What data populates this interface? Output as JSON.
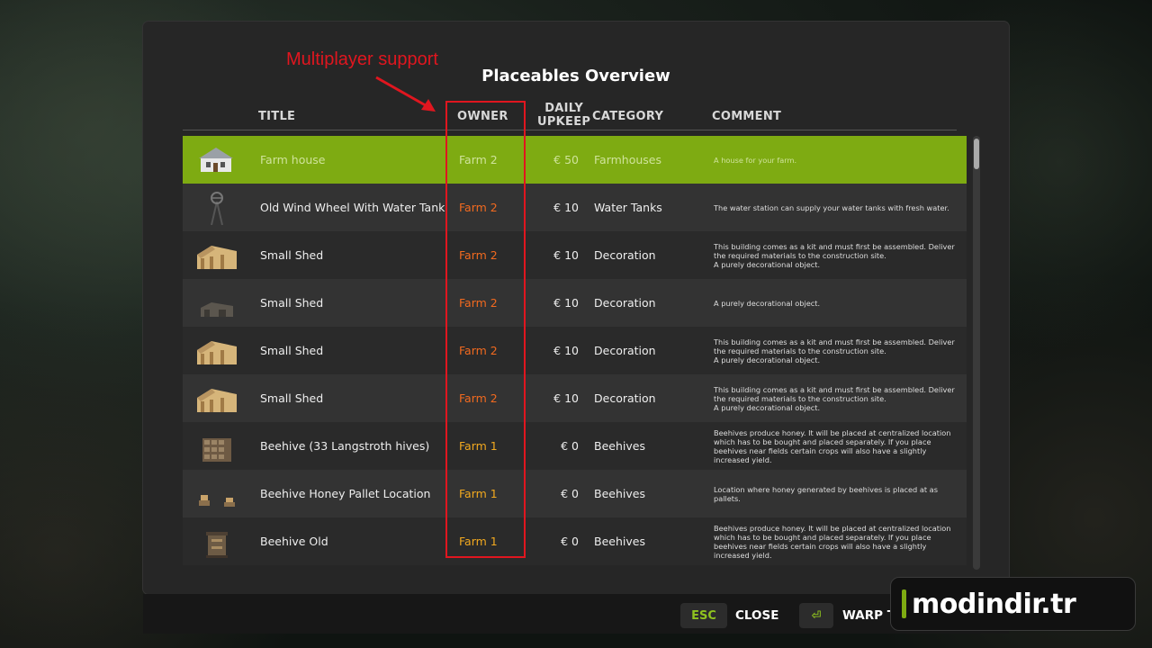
{
  "panel": {
    "title": "Placeables Overview"
  },
  "annotation": {
    "label": "Multiplayer support",
    "color": "#e0161f"
  },
  "columns": {
    "title": "TITLE",
    "owner": "OWNER",
    "upkeep_line1": "DAILY",
    "upkeep_line2": "UPKEEP",
    "category": "CATEGORY",
    "comment": "COMMENT"
  },
  "colors": {
    "selected_row": "#7eab12",
    "farm2": "#f26a1f",
    "farm1": "#f2a91f",
    "accent": "#8fc31f"
  },
  "rows": [
    {
      "title": "Farm house",
      "owner": "Farm 2",
      "upkeep": "€ 50",
      "category": "Farmhouses",
      "comment": [
        "A house for your farm."
      ],
      "icon": "farmhouse-icon",
      "selected": true
    },
    {
      "title": "Old Wind Wheel With Water Tank",
      "owner": "Farm 2",
      "upkeep": "€ 10",
      "category": "Water Tanks",
      "comment": [
        "The water station can supply your water tanks with fresh water."
      ],
      "icon": "windwheel-icon"
    },
    {
      "title": "Small Shed",
      "owner": "Farm 2",
      "upkeep": "€ 10",
      "category": "Decoration",
      "comment": [
        "This building comes as a kit and must first be assembled. Deliver the required materials to the construction site.",
        "A purely decorational object."
      ],
      "icon": "shed-icon"
    },
    {
      "title": "Small Shed",
      "owner": "Farm 2",
      "upkeep": "€ 10",
      "category": "Decoration",
      "comment": [
        "A purely decorational object."
      ],
      "icon": "shed-dark-icon"
    },
    {
      "title": "Small Shed",
      "owner": "Farm 2",
      "upkeep": "€ 10",
      "category": "Decoration",
      "comment": [
        "This building comes as a kit and must first be assembled. Deliver the required materials to the construction site.",
        "A purely decorational object."
      ],
      "icon": "shed-icon"
    },
    {
      "title": "Small Shed",
      "owner": "Farm 2",
      "upkeep": "€ 10",
      "category": "Decoration",
      "comment": [
        "This building comes as a kit and must first be assembled. Deliver the required materials to the construction site.",
        "A purely decorational object."
      ],
      "icon": "shed-icon"
    },
    {
      "title": "Beehive (33 Langstroth hives)",
      "owner": "Farm 1",
      "upkeep": "€ 0",
      "category": "Beehives",
      "comment": [
        "Beehives produce honey. It will be placed at centralized location which has to be bought and placed separately. If you place beehives near fields certain crops will also have a slightly increased yield."
      ],
      "icon": "beehive-rack-icon"
    },
    {
      "title": "Beehive Honey Pallet Location",
      "owner": "Farm 1",
      "upkeep": "€ 0",
      "category": "Beehives",
      "comment": [
        "Location where honey generated by beehives is placed at as pallets."
      ],
      "icon": "pallet-icon"
    },
    {
      "title": "Beehive Old",
      "owner": "Farm 1",
      "upkeep": "€ 0",
      "category": "Beehives",
      "comment": [
        "Beehives produce honey. It will be placed at centralized location which has to be bought and placed separately. If you place beehives near fields certain crops will also have a slightly increased yield."
      ],
      "icon": "beehive-old-icon"
    }
  ],
  "footer": {
    "esc_key": "ESC",
    "close_label": "CLOSE",
    "enter_key": "⏎",
    "warp_label": "WARP TO LOCATION"
  },
  "watermark": {
    "text": "modindir.tr"
  }
}
